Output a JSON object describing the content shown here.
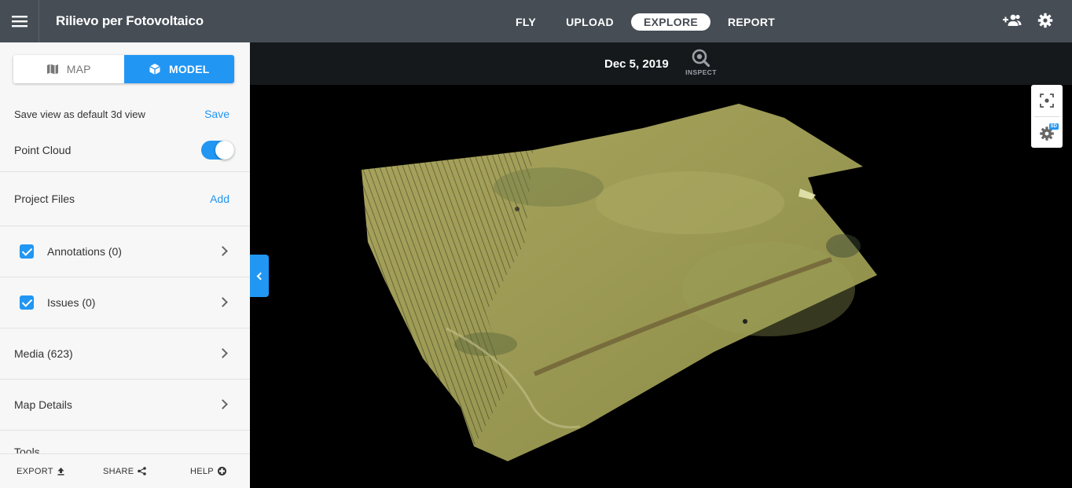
{
  "app": {
    "title": "Rilievo per Fotovoltaico"
  },
  "nav": {
    "items": [
      {
        "label": "FLY"
      },
      {
        "label": "UPLOAD"
      },
      {
        "label": "EXPLORE",
        "active": true
      },
      {
        "label": "REPORT"
      }
    ]
  },
  "header_icons": [
    "menu-icon",
    "add-user-icon",
    "gear-icon"
  ],
  "sidebar": {
    "view_toggle": {
      "map_label": "MAP",
      "model_label": "MODEL",
      "selected": "MODEL"
    },
    "save_view": {
      "label": "Save view as default 3d view",
      "action": "Save"
    },
    "point_cloud": {
      "label": "Point Cloud",
      "enabled": true
    },
    "project_files": {
      "label": "Project Files",
      "action": "Add"
    },
    "annotations": {
      "label": "Annotations (0)",
      "checked": true
    },
    "issues": {
      "label": "Issues (0)",
      "checked": true
    },
    "media": {
      "label": "Media (623)"
    },
    "map_details": {
      "label": "Map Details"
    },
    "tools": {
      "label": "Tools"
    },
    "footer": {
      "export": "EXPORT",
      "share": "SHARE",
      "help": "HELP"
    }
  },
  "viewer": {
    "date": "Dec 5, 2019",
    "inspect_label": "INSPECT",
    "badge": "SD",
    "tool_icons": [
      "focus-icon",
      "settings-3d-icon"
    ]
  },
  "colors": {
    "topbar": "#464d55",
    "accent": "#2196f3",
    "datebar": "#16191c",
    "sidebar": "#f7f7f7"
  }
}
